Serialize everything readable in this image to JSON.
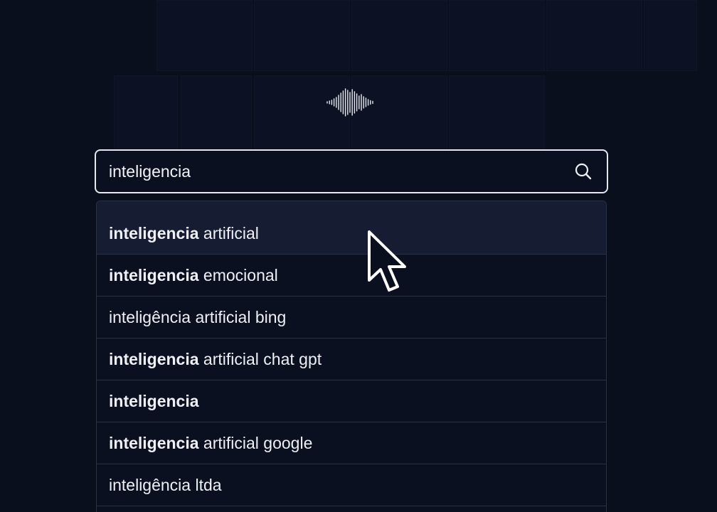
{
  "search": {
    "query": "inteligencia",
    "submit_icon": "search-icon"
  },
  "logo": {
    "icon": "soundwave-logo-icon"
  },
  "suggestions": [
    {
      "bold": "inteligencia",
      "rest": " artificial",
      "active": true
    },
    {
      "bold": "inteligencia",
      "rest": " emocional",
      "active": false
    },
    {
      "bold": "",
      "rest": "inteligência artificial bing",
      "active": false
    },
    {
      "bold": "inteligencia",
      "rest": " artificial chat gpt",
      "active": false
    },
    {
      "bold": "inteligencia",
      "rest": "",
      "active": false
    },
    {
      "bold": "inteligencia",
      "rest": " artificial google",
      "active": false
    },
    {
      "bold": "",
      "rest": "inteligência ltda",
      "active": false
    }
  ],
  "colors": {
    "background": "#0a0f1e",
    "border": "#e6e8ee",
    "active_row": "#161d33",
    "text": "#eef0f5"
  }
}
